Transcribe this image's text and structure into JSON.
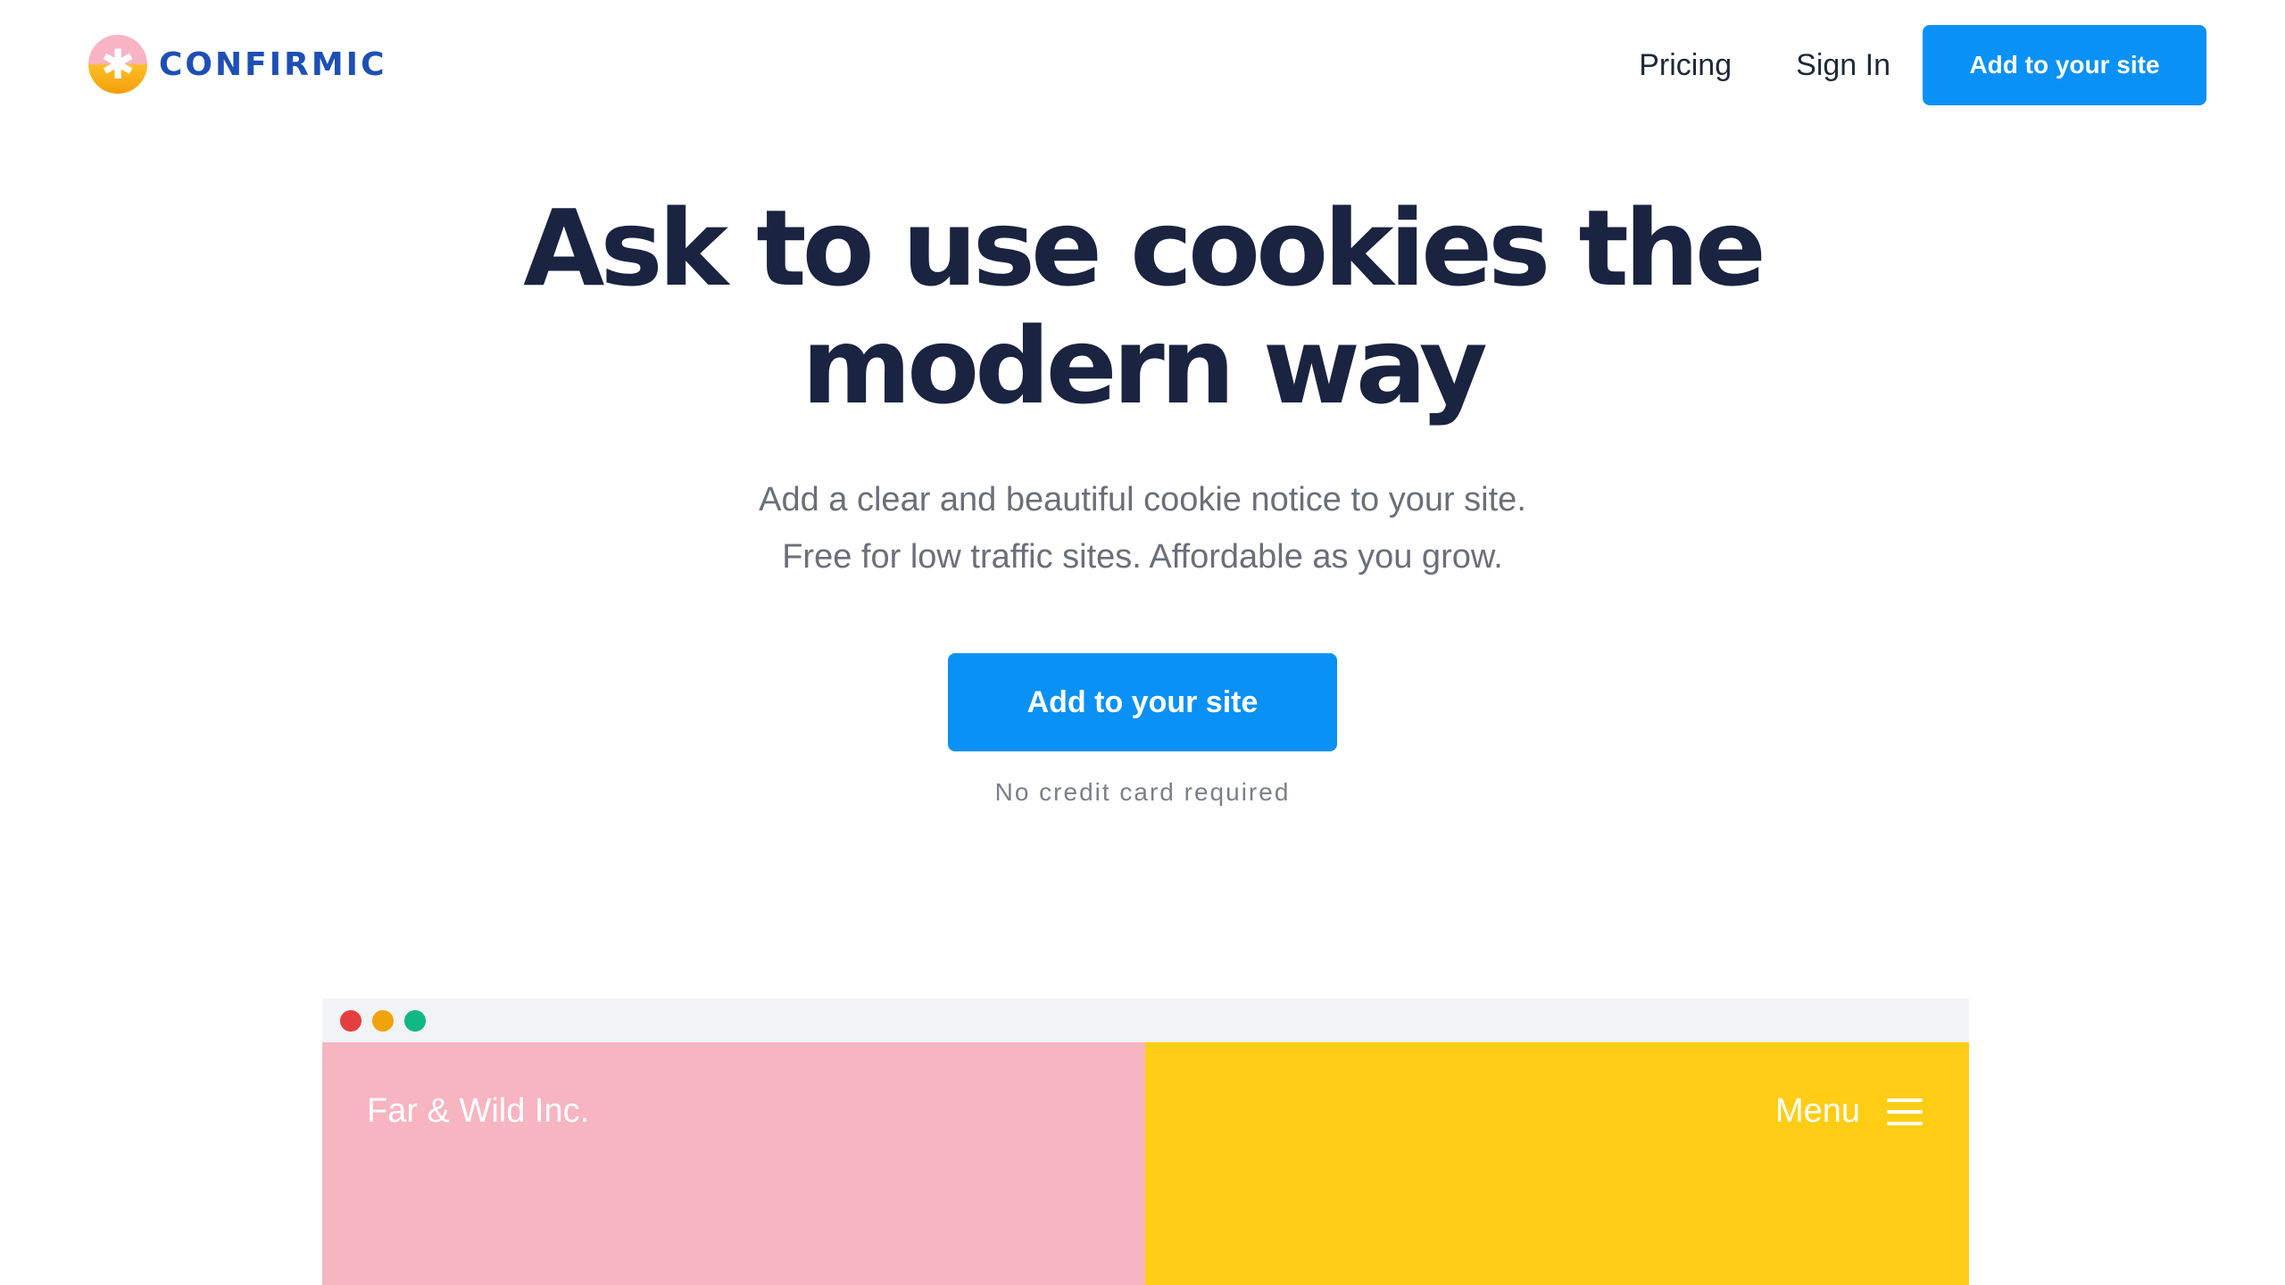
{
  "header": {
    "brand_name": "CONFIRMIC",
    "brand_icon": "asterisk-logo-icon",
    "nav": [
      {
        "label": "Pricing"
      },
      {
        "label": "Sign In"
      }
    ],
    "cta_label": "Add to your site"
  },
  "hero": {
    "title": "Ask to use cookies the modern way",
    "subtitle_lines": [
      "Add a clear and beautiful cookie notice to your site.",
      "Free for low traffic sites. Affordable as you grow."
    ],
    "cta_label": "Add to your site",
    "note": "No credit card required"
  },
  "preview": {
    "site_name": "Far & Wild Inc.",
    "menu_label": "Menu",
    "menu_icon": "hamburger-icon"
  },
  "colors": {
    "brand": "#1e4fb5",
    "accent": "#0a91f5",
    "title": "#1a2340",
    "preview_pink": "#f7b4c1",
    "preview_yellow": "#fecd14",
    "dot_red": "#e53e3e",
    "dot_yellow": "#f2a20b",
    "dot_green": "#10b981"
  }
}
